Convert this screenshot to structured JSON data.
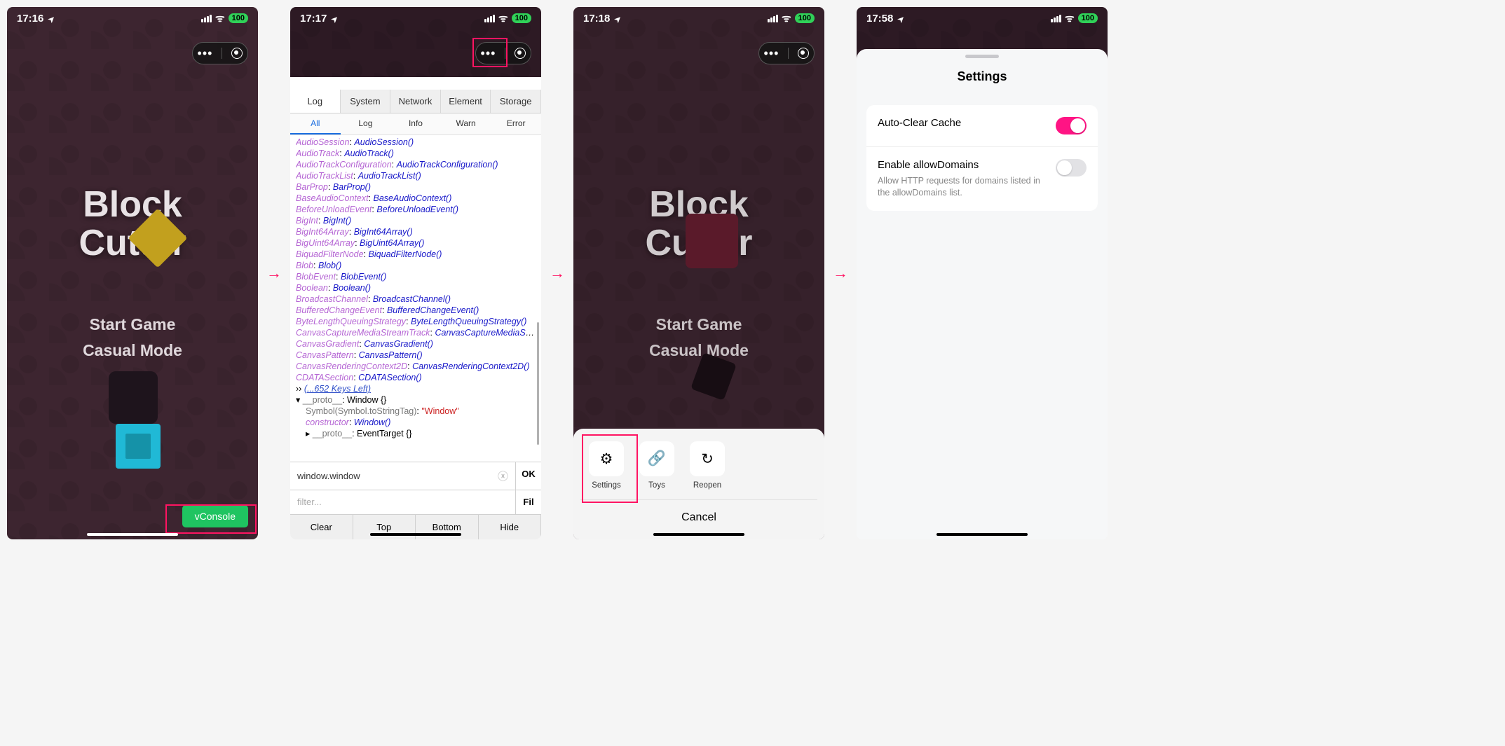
{
  "status": {
    "battery": "100",
    "wifi": true
  },
  "times": {
    "s1": "17:16",
    "s2": "17:17",
    "s3": "17:18",
    "s4": "17:58"
  },
  "game": {
    "title_l1": "Block",
    "title_l2": "Cutter",
    "menu_start": "Start Game",
    "menu_casual": "Casual Mode",
    "vconsole_btn": "vConsole"
  },
  "vconsole": {
    "tabs": [
      "Log",
      "System",
      "Network",
      "Element",
      "Storage"
    ],
    "subtabs": [
      "All",
      "Log",
      "Info",
      "Warn",
      "Error"
    ],
    "active_tab": 0,
    "active_sub": 0,
    "log": [
      {
        "k": "AudioSession",
        "v": "AudioSession()"
      },
      {
        "k": "AudioTrack",
        "v": "AudioTrack()"
      },
      {
        "k": "AudioTrackConfiguration",
        "v": "AudioTrackConfiguration()"
      },
      {
        "k": "AudioTrackList",
        "v": "AudioTrackList()"
      },
      {
        "k": "BarProp",
        "v": "BarProp()"
      },
      {
        "k": "BaseAudioContext",
        "v": "BaseAudioContext()"
      },
      {
        "k": "BeforeUnloadEvent",
        "v": "BeforeUnloadEvent()"
      },
      {
        "k": "BigInt",
        "v": "BigInt()"
      },
      {
        "k": "BigInt64Array",
        "v": "BigInt64Array()"
      },
      {
        "k": "BigUint64Array",
        "v": "BigUint64Array()"
      },
      {
        "k": "BiquadFilterNode",
        "v": "BiquadFilterNode()"
      },
      {
        "k": "Blob",
        "v": "Blob()"
      },
      {
        "k": "BlobEvent",
        "v": "BlobEvent()"
      },
      {
        "k": "Boolean",
        "v": "Boolean()"
      },
      {
        "k": "BroadcastChannel",
        "v": "BroadcastChannel()"
      },
      {
        "k": "BufferedChangeEvent",
        "v": "BufferedChangeEvent()"
      },
      {
        "k": "ByteLengthQueuingStrategy",
        "v": "ByteLengthQueuingStrategy()"
      },
      {
        "k": "CanvasCaptureMediaStreamTrack",
        "v": "CanvasCaptureMediaStreamTrack()"
      },
      {
        "k": "CanvasGradient",
        "v": "CanvasGradient()"
      },
      {
        "k": "CanvasPattern",
        "v": "CanvasPattern()"
      },
      {
        "k": "CanvasRenderingContext2D",
        "v": "CanvasRenderingContext2D()"
      },
      {
        "k": "CDATASection",
        "v": "CDATASection()"
      }
    ],
    "more": "(...652 Keys Left)",
    "proto1_k": "__proto__",
    "proto1_v": "Window {}",
    "symbol_k": "Symbol(Symbol.toStringTag)",
    "symbol_v": "\"Window\"",
    "constructor_k": "constructor",
    "constructor_v": "Window()",
    "proto2_k": "__proto__",
    "proto2_v": "EventTarget {}",
    "cmd_value": "window.window",
    "ok": "OK",
    "filter_ph": "filter...",
    "fil": "Fil",
    "btns": [
      "Clear",
      "Top",
      "Bottom",
      "Hide"
    ]
  },
  "sheet": {
    "items": [
      {
        "icon": "⚙",
        "label": "Settings"
      },
      {
        "icon": "🔗",
        "label": "Toys"
      },
      {
        "icon": "↻",
        "label": "Reopen"
      }
    ],
    "cancel": "Cancel"
  },
  "settings": {
    "title": "Settings",
    "rows": [
      {
        "main": "Auto-Clear Cache",
        "sub": "",
        "on": true
      },
      {
        "main": "Enable allowDomains",
        "sub": "Allow HTTP requests for domains listed in the allowDomains list.",
        "on": false
      }
    ]
  }
}
